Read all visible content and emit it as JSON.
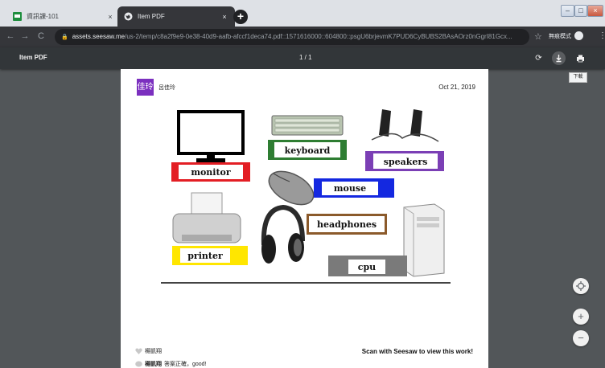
{
  "tabs": [
    {
      "label": "資訊課-101",
      "close": "×"
    },
    {
      "label": "Item PDF",
      "close": "×"
    }
  ],
  "new_tab": "+",
  "address": {
    "host": "assets.seesaw.me",
    "path": "/us-2/temp/c8a2f9e9-0e38-40d9-aafb-afccf1deca74.pdf::1571616000::604800::psgU6brjevmK7PUD6CyBUBS2BAsAOrz0nGgrI81Gcx..."
  },
  "toolbar": {
    "incognito_label": "無痕模式"
  },
  "pdf": {
    "title": "Item PDF",
    "page_indicator": "1 / 1",
    "tooltip": "下載"
  },
  "page": {
    "author_initials": "佳玲",
    "author_name": "呂佳玲",
    "date": "Oct 21, 2019",
    "labels": {
      "monitor": "monitor",
      "keyboard": "keyboard",
      "speakers": "speakers",
      "mouse": "mouse",
      "headphones": "headphones",
      "printer": "printer",
      "cpu": "cpu"
    },
    "comments": [
      {
        "author": "楊凱翔",
        "text": ""
      },
      {
        "author": "楊凱翔",
        "text": "答案正確，good!"
      }
    ],
    "scan_text": "Scan with Seesaw to view this work!"
  },
  "colors": {
    "monitor_box": "#e31e24",
    "keyboard_box": "#2e7d32",
    "speakers_box": "#7b3fb5",
    "mouse_box": "#1428e0",
    "headphones_box": "#8b5a2b",
    "printer_box": "#ffe600",
    "cpu_box": "#7a7a7a",
    "author_box": "#7b2fbf"
  },
  "icons": {
    "reload": "reload-icon",
    "download": "download-icon",
    "print": "print-icon"
  }
}
